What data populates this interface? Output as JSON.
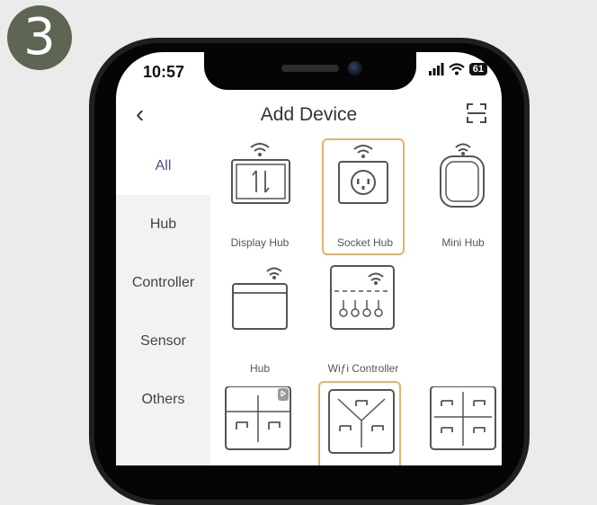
{
  "step_number": "3",
  "status_bar": {
    "time": "10:57",
    "battery": "61"
  },
  "header": {
    "title": "Add Device"
  },
  "sidebar": {
    "items": [
      {
        "label": "All"
      },
      {
        "label": "Hub"
      },
      {
        "label": "Controller"
      },
      {
        "label": "Sensor"
      },
      {
        "label": "Others"
      }
    ]
  },
  "devices": [
    {
      "label": "Display Hub"
    },
    {
      "label": "Socket Hub"
    },
    {
      "label": "Mini Hub"
    },
    {
      "label": "Hub"
    },
    {
      "label": "Wiƒi Controller"
    }
  ],
  "colors": {
    "accent": "#4a4e8a",
    "selected_border": "#e9b06a",
    "badge": "#5e6552"
  }
}
